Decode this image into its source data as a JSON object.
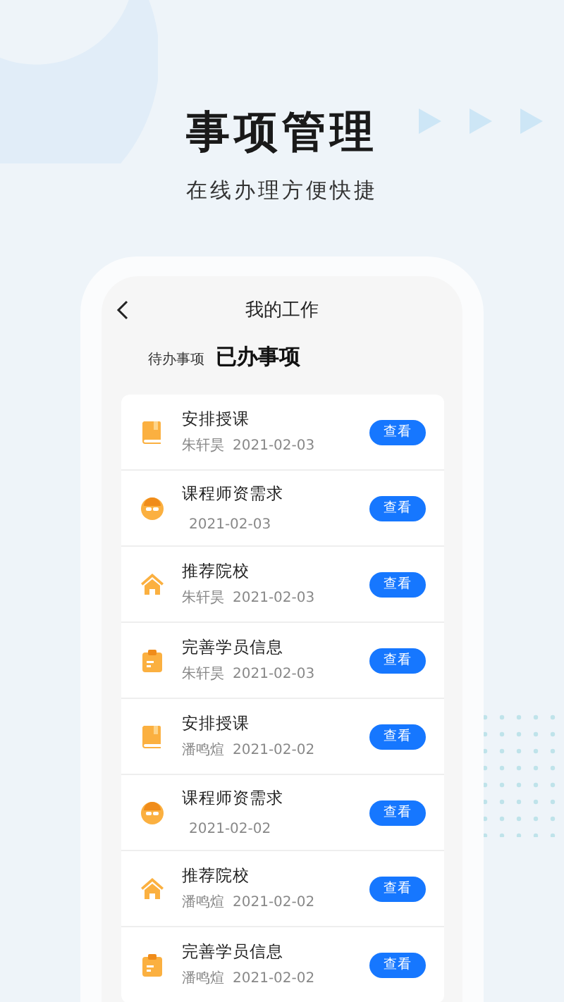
{
  "headline": "事项管理",
  "subheadline": "在线办理方便快捷",
  "screen": {
    "title": "我的工作",
    "tabs": [
      {
        "label": "待办事项",
        "selected": false
      },
      {
        "label": "已办事项",
        "selected": true
      }
    ],
    "items": [
      {
        "kind": "book",
        "title": "安排授课",
        "person": "朱轩昊",
        "date": "2021-02-03",
        "action": "查看"
      },
      {
        "kind": "face",
        "title": "课程师资需求",
        "date": "2021-02-03",
        "action": "查看"
      },
      {
        "kind": "house",
        "title": "推荐院校",
        "person": "朱轩昊",
        "date": "2021-02-03",
        "action": "查看"
      },
      {
        "kind": "clipboard",
        "title": "完善学员信息",
        "person": "朱轩昊",
        "date": "2021-02-03",
        "action": "查看"
      },
      {
        "kind": "book",
        "title": "安排授课",
        "person": "潘鸣煊",
        "date": "2021-02-02",
        "action": "查看"
      },
      {
        "kind": "face",
        "title": "课程师资需求",
        "date": "2021-02-02",
        "action": "查看"
      },
      {
        "kind": "house",
        "title": "推荐院校",
        "person": "潘鸣煊",
        "date": "2021-02-02",
        "action": "查看"
      },
      {
        "kind": "clipboard",
        "title": "完善学员信息",
        "person": "潘鸣煊",
        "date": "2021-02-02",
        "action": "查看"
      }
    ]
  }
}
